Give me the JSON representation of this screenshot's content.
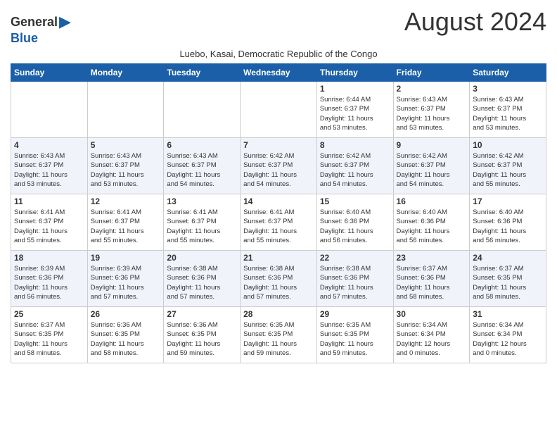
{
  "header": {
    "logo_general": "General",
    "logo_blue": "Blue",
    "month_title": "August 2024",
    "subtitle": "Luebo, Kasai, Democratic Republic of the Congo"
  },
  "weekdays": [
    "Sunday",
    "Monday",
    "Tuesday",
    "Wednesday",
    "Thursday",
    "Friday",
    "Saturday"
  ],
  "weeks": [
    [
      {
        "day": "",
        "info": ""
      },
      {
        "day": "",
        "info": ""
      },
      {
        "day": "",
        "info": ""
      },
      {
        "day": "",
        "info": ""
      },
      {
        "day": "1",
        "info": "Sunrise: 6:44 AM\nSunset: 6:37 PM\nDaylight: 11 hours\nand 53 minutes."
      },
      {
        "day": "2",
        "info": "Sunrise: 6:43 AM\nSunset: 6:37 PM\nDaylight: 11 hours\nand 53 minutes."
      },
      {
        "day": "3",
        "info": "Sunrise: 6:43 AM\nSunset: 6:37 PM\nDaylight: 11 hours\nand 53 minutes."
      }
    ],
    [
      {
        "day": "4",
        "info": "Sunrise: 6:43 AM\nSunset: 6:37 PM\nDaylight: 11 hours\nand 53 minutes."
      },
      {
        "day": "5",
        "info": "Sunrise: 6:43 AM\nSunset: 6:37 PM\nDaylight: 11 hours\nand 53 minutes."
      },
      {
        "day": "6",
        "info": "Sunrise: 6:43 AM\nSunset: 6:37 PM\nDaylight: 11 hours\nand 54 minutes."
      },
      {
        "day": "7",
        "info": "Sunrise: 6:42 AM\nSunset: 6:37 PM\nDaylight: 11 hours\nand 54 minutes."
      },
      {
        "day": "8",
        "info": "Sunrise: 6:42 AM\nSunset: 6:37 PM\nDaylight: 11 hours\nand 54 minutes."
      },
      {
        "day": "9",
        "info": "Sunrise: 6:42 AM\nSunset: 6:37 PM\nDaylight: 11 hours\nand 54 minutes."
      },
      {
        "day": "10",
        "info": "Sunrise: 6:42 AM\nSunset: 6:37 PM\nDaylight: 11 hours\nand 55 minutes."
      }
    ],
    [
      {
        "day": "11",
        "info": "Sunrise: 6:41 AM\nSunset: 6:37 PM\nDaylight: 11 hours\nand 55 minutes."
      },
      {
        "day": "12",
        "info": "Sunrise: 6:41 AM\nSunset: 6:37 PM\nDaylight: 11 hours\nand 55 minutes."
      },
      {
        "day": "13",
        "info": "Sunrise: 6:41 AM\nSunset: 6:37 PM\nDaylight: 11 hours\nand 55 minutes."
      },
      {
        "day": "14",
        "info": "Sunrise: 6:41 AM\nSunset: 6:37 PM\nDaylight: 11 hours\nand 55 minutes."
      },
      {
        "day": "15",
        "info": "Sunrise: 6:40 AM\nSunset: 6:36 PM\nDaylight: 11 hours\nand 56 minutes."
      },
      {
        "day": "16",
        "info": "Sunrise: 6:40 AM\nSunset: 6:36 PM\nDaylight: 11 hours\nand 56 minutes."
      },
      {
        "day": "17",
        "info": "Sunrise: 6:40 AM\nSunset: 6:36 PM\nDaylight: 11 hours\nand 56 minutes."
      }
    ],
    [
      {
        "day": "18",
        "info": "Sunrise: 6:39 AM\nSunset: 6:36 PM\nDaylight: 11 hours\nand 56 minutes."
      },
      {
        "day": "19",
        "info": "Sunrise: 6:39 AM\nSunset: 6:36 PM\nDaylight: 11 hours\nand 57 minutes."
      },
      {
        "day": "20",
        "info": "Sunrise: 6:38 AM\nSunset: 6:36 PM\nDaylight: 11 hours\nand 57 minutes."
      },
      {
        "day": "21",
        "info": "Sunrise: 6:38 AM\nSunset: 6:36 PM\nDaylight: 11 hours\nand 57 minutes."
      },
      {
        "day": "22",
        "info": "Sunrise: 6:38 AM\nSunset: 6:36 PM\nDaylight: 11 hours\nand 57 minutes."
      },
      {
        "day": "23",
        "info": "Sunrise: 6:37 AM\nSunset: 6:36 PM\nDaylight: 11 hours\nand 58 minutes."
      },
      {
        "day": "24",
        "info": "Sunrise: 6:37 AM\nSunset: 6:35 PM\nDaylight: 11 hours\nand 58 minutes."
      }
    ],
    [
      {
        "day": "25",
        "info": "Sunrise: 6:37 AM\nSunset: 6:35 PM\nDaylight: 11 hours\nand 58 minutes."
      },
      {
        "day": "26",
        "info": "Sunrise: 6:36 AM\nSunset: 6:35 PM\nDaylight: 11 hours\nand 58 minutes."
      },
      {
        "day": "27",
        "info": "Sunrise: 6:36 AM\nSunset: 6:35 PM\nDaylight: 11 hours\nand 59 minutes."
      },
      {
        "day": "28",
        "info": "Sunrise: 6:35 AM\nSunset: 6:35 PM\nDaylight: 11 hours\nand 59 minutes."
      },
      {
        "day": "29",
        "info": "Sunrise: 6:35 AM\nSunset: 6:35 PM\nDaylight: 11 hours\nand 59 minutes."
      },
      {
        "day": "30",
        "info": "Sunrise: 6:34 AM\nSunset: 6:34 PM\nDaylight: 12 hours\nand 0 minutes."
      },
      {
        "day": "31",
        "info": "Sunrise: 6:34 AM\nSunset: 6:34 PM\nDaylight: 12 hours\nand 0 minutes."
      }
    ]
  ]
}
